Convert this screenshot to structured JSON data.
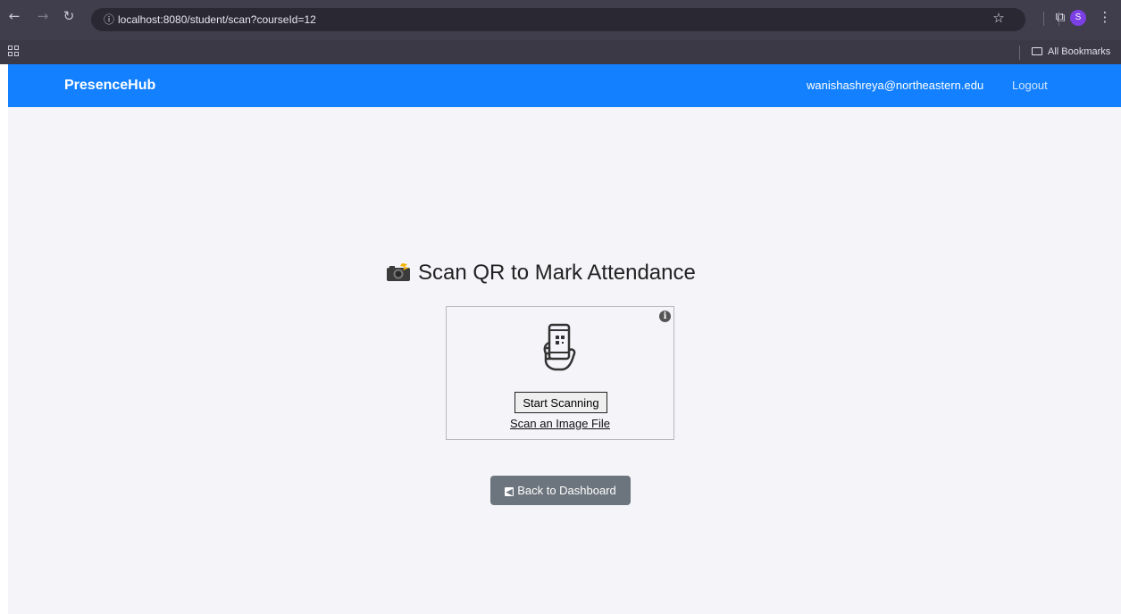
{
  "browser": {
    "url": "localhost:8080/student/scan?courseId=12",
    "bookmarks_label": "All Bookmarks",
    "profile_initial": "S",
    "icons": [
      "back-icon",
      "forward-icon",
      "reload-icon",
      "site-info-icon",
      "star-icon",
      "extensions-icon",
      "menu-icon",
      "apps-icon",
      "folder-icon"
    ]
  },
  "navbar": {
    "brand": "PresenceHub",
    "user_email": "wanishashreya@northeastern.edu",
    "logout_label": "Logout",
    "color": "#1380ff"
  },
  "main": {
    "title": "Scan QR to Mark Attendance",
    "title_icon": "camera-flash-icon",
    "scanner": {
      "start_label": "Start Scanning",
      "file_label": "Scan an Image File",
      "info_icon": "info-icon",
      "illustration_icon": "phone-qr-icon"
    },
    "back_label": "Back to Dashboard",
    "back_icon": "back-arrow-icon",
    "back_color": "#6c757d"
  }
}
